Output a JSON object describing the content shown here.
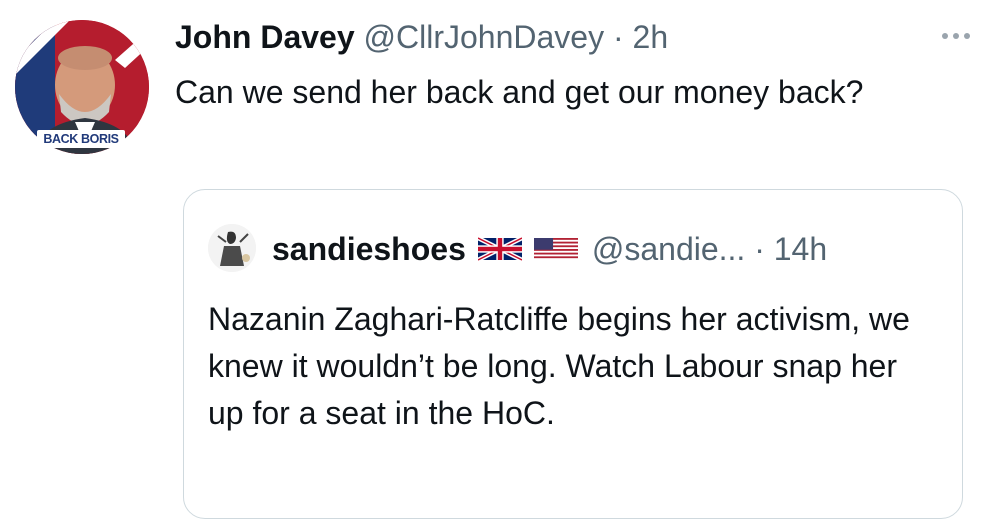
{
  "tweet": {
    "author": {
      "name": "John Davey",
      "handle": "@CllrJohnDavey",
      "avatar_badge": "BACK BORIS"
    },
    "separator": "·",
    "time": "2h",
    "text": "Can we send her back and get our money back?"
  },
  "quoted_tweet": {
    "author": {
      "name": "sandieshoes",
      "flags": [
        "uk-flag-icon",
        "us-flag-icon"
      ],
      "handle": "@sandie... · 14h"
    },
    "text": "Nazanin Zaghari-Ratcliffe begins her activism, we knew it wouldn’t be long. Watch Labour snap her up for a seat in the HoC."
  },
  "colors": {
    "text": "#0f1419",
    "secondary": "#536471",
    "border": "#cfd9de"
  }
}
